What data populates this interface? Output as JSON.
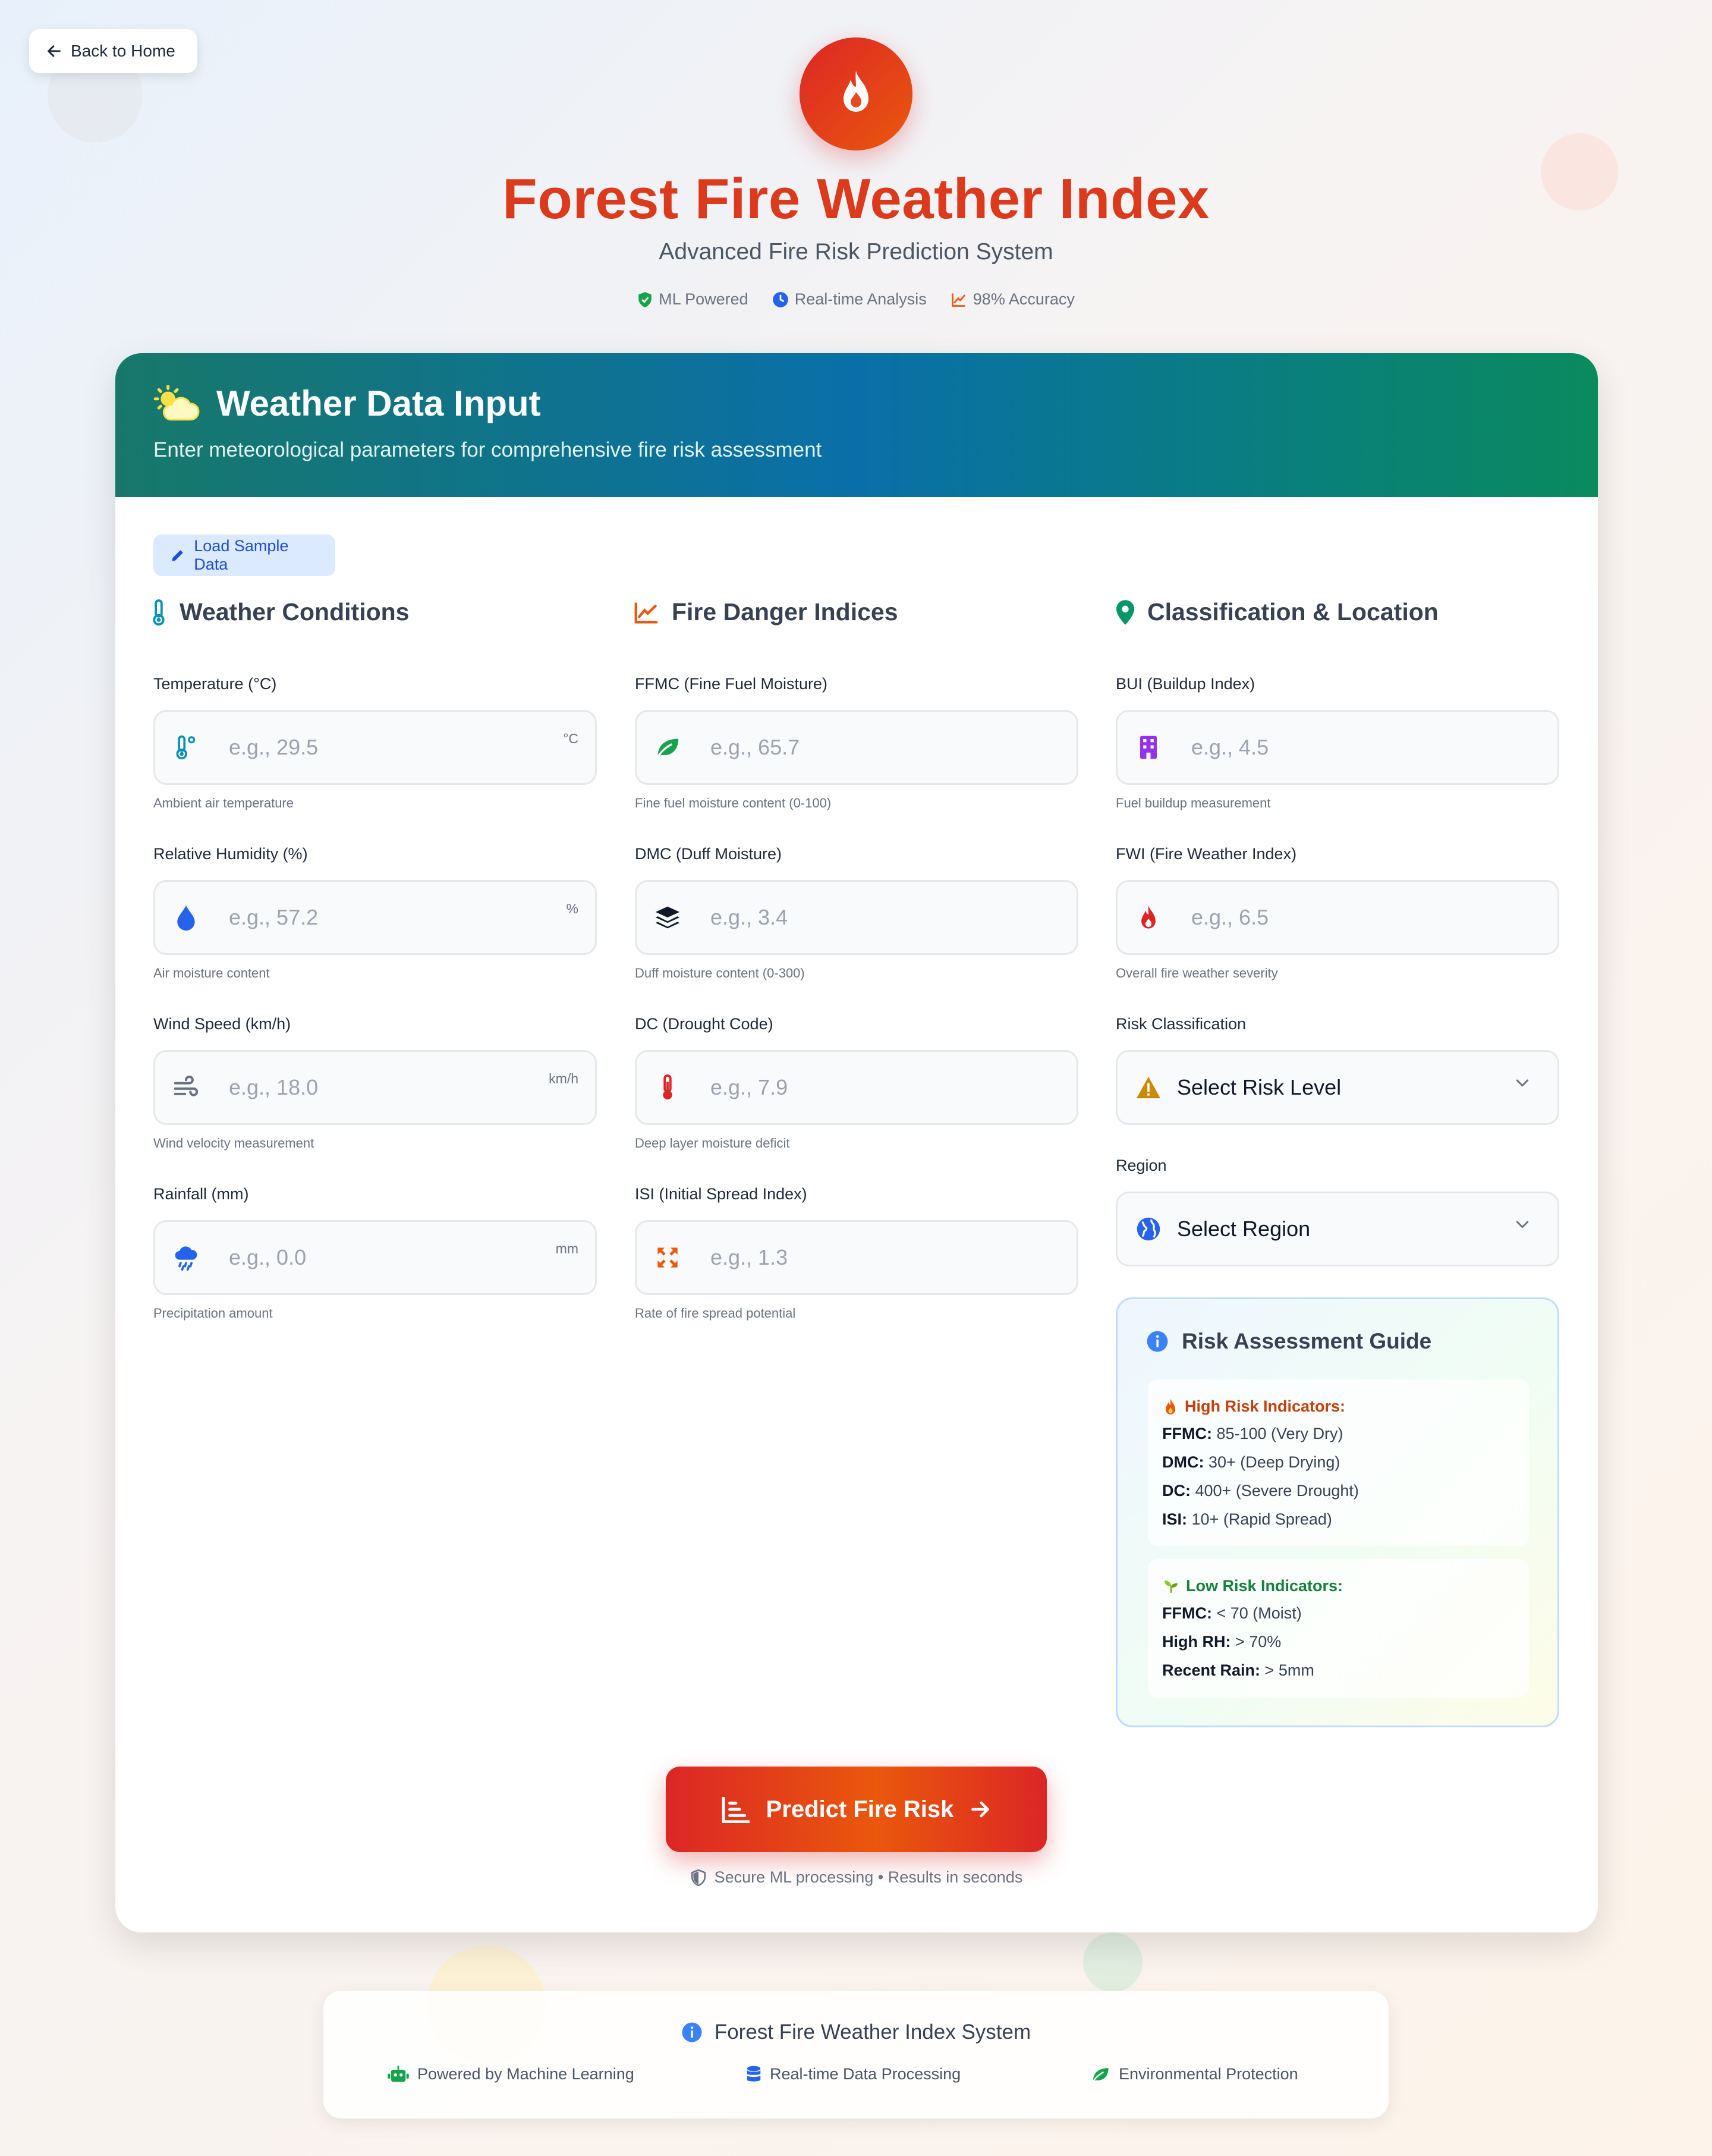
{
  "nav": {
    "back_label": "Back to Home"
  },
  "hero": {
    "title": "Forest Fire Weather Index",
    "subtitle": "Advanced Fire Risk Prediction System",
    "badges": [
      {
        "label": "ML Powered",
        "icon": "shield-check-icon",
        "color": "#16a34a"
      },
      {
        "label": "Real-time Analysis",
        "icon": "clock-icon",
        "color": "#2563eb"
      },
      {
        "label": "98% Accuracy",
        "icon": "chart-line-icon",
        "color": "#ea580c"
      }
    ]
  },
  "card": {
    "title": "Weather Data Input",
    "description": "Enter meteorological parameters for comprehensive fire risk assessment",
    "sample_button": "Load Sample Data",
    "columns": {
      "weather": "Weather Conditions",
      "fire": "Fire Danger Indices",
      "classification": "Classification & Location"
    },
    "weather_fields": [
      {
        "label": "Temperature (°C)",
        "placeholder": "e.g., 29.5",
        "unit": "°C",
        "hint": "Ambient air temperature",
        "icon": "thermometer-icon"
      },
      {
        "label": "Relative Humidity (%)",
        "placeholder": "e.g., 57.2",
        "unit": "%",
        "hint": "Air moisture content",
        "icon": "droplet-icon"
      },
      {
        "label": "Wind Speed (km/h)",
        "placeholder": "e.g., 18.0",
        "unit": "km/h",
        "hint": "Wind velocity measurement",
        "icon": "wind-icon"
      },
      {
        "label": "Rainfall (mm)",
        "placeholder": "e.g., 0.0",
        "unit": "mm",
        "hint": "Precipitation amount",
        "icon": "cloud-rain-icon"
      }
    ],
    "fire_fields": [
      {
        "label": "FFMC (Fine Fuel Moisture)",
        "placeholder": "e.g., 65.7",
        "hint": "Fine fuel moisture content (0-100)",
        "icon": "leaf-icon"
      },
      {
        "label": "DMC (Duff Moisture)",
        "placeholder": "e.g., 3.4",
        "hint": "Duff moisture content (0-300)",
        "icon": "layers-icon"
      },
      {
        "label": "DC (Drought Code)",
        "placeholder": "e.g., 7.9",
        "hint": "Deep layer moisture deficit",
        "icon": "thermometer-hot-icon"
      },
      {
        "label": "ISI (Initial Spread Index)",
        "placeholder": "e.g., 1.3",
        "hint": "Rate of fire spread potential",
        "icon": "expand-arrows-icon"
      }
    ],
    "class_fields": [
      {
        "label": "BUI (Buildup Index)",
        "placeholder": "e.g., 4.5",
        "hint": "Fuel buildup measurement",
        "icon": "building-icon"
      },
      {
        "label": "FWI (Fire Weather Index)",
        "placeholder": "e.g., 6.5",
        "hint": "Overall fire weather severity",
        "icon": "fire-icon"
      }
    ],
    "risk_select": {
      "label": "Risk Classification",
      "value": "Select Risk Level",
      "icon": "warning-icon"
    },
    "region_select": {
      "label": "Region",
      "value": "Select Region",
      "icon": "globe-icon"
    },
    "guide": {
      "title": "Risk Assessment Guide",
      "high": {
        "heading": "High Risk Indicators:",
        "items": [
          {
            "key": "FFMC:",
            "value": " 85-100 (Very Dry)"
          },
          {
            "key": "DMC:",
            "value": " 30+ (Deep Drying)"
          },
          {
            "key": "DC:",
            "value": " 400+ (Severe Drought)"
          },
          {
            "key": "ISI:",
            "value": " 10+ (Rapid Spread)"
          }
        ]
      },
      "low": {
        "heading": "Low Risk Indicators:",
        "items": [
          {
            "key": "FFMC:",
            "value": " < 70 (Moist)"
          },
          {
            "key": "High RH:",
            "value": " > 70%"
          },
          {
            "key": "Recent Rain:",
            "value": " > 5mm"
          }
        ]
      }
    },
    "predict_button": "Predict Fire Risk",
    "secure_note": "Secure ML processing • Results in seconds"
  },
  "footer": {
    "title": "Forest Fire Weather Index System",
    "items": [
      {
        "label": "Powered by Machine Learning",
        "icon": "robot-icon"
      },
      {
        "label": "Real-time Data Processing",
        "icon": "database-icon"
      },
      {
        "label": "Environmental Protection",
        "icon": "leaf-icon"
      }
    ]
  },
  "colors": {
    "brand_red": "#dc3a1c",
    "header_gradient": [
      "#17786a",
      "#0a6fa8",
      "#0a8a5e"
    ],
    "high_risk": "#c2410c",
    "low_risk": "#15803d"
  }
}
